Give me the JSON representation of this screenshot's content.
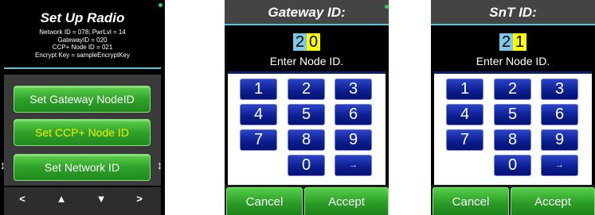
{
  "screen1": {
    "title": "Set Up Radio",
    "info_lines": [
      "Network ID = 078; PwrLvl = 14",
      "GatewayID = 020",
      "CCP+ Node ID = 021",
      "Encrypt Key = sampleEncryptKey"
    ],
    "menu": [
      {
        "label": "Set Gateway NodeID",
        "selected": false
      },
      {
        "label": "Set CCP+ Node ID",
        "selected": true
      },
      {
        "label": "Set Network ID",
        "selected": false
      }
    ],
    "scroll_arrow_left": "↕",
    "scroll_arrow_right": "↕",
    "nav": {
      "left": "<",
      "up": "▲",
      "down": "▼",
      "right": ">"
    }
  },
  "screen2": {
    "title": "Gateway ID:",
    "digits": [
      "2",
      "0"
    ],
    "prompt": "Enter Node ID.",
    "keys": [
      "1",
      "2",
      "3",
      "4",
      "5",
      "6",
      "7",
      "8",
      "9",
      "0",
      "→"
    ],
    "cancel": "Cancel",
    "accept": "Accept"
  },
  "screen3": {
    "title": "SnT ID:",
    "digits": [
      "2",
      "1"
    ],
    "prompt": "Enter Node ID.",
    "keys": [
      "1",
      "2",
      "3",
      "4",
      "5",
      "6",
      "7",
      "8",
      "9",
      "0",
      "→"
    ],
    "cancel": "Cancel",
    "accept": "Accept"
  },
  "colors": {
    "accent_cyan": "#56c9dc",
    "button_green": "#2fa12a",
    "selected_text": "#f4f000",
    "key_blue": "#0b1d8e",
    "current_digit": "#ffff00",
    "prev_digit": "#7ec8e8"
  }
}
